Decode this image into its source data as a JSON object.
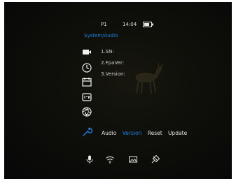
{
  "status_bar": {
    "profile": "P1",
    "time": "14:04"
  },
  "breadcrumb": "System/Audio",
  "info": {
    "sn_label": "1.SN:",
    "fpaver_label": "2.FpaVer:",
    "version_label": "3.Version:"
  },
  "tabs": [
    {
      "label": "Audio",
      "active": false
    },
    {
      "label": "Version",
      "active": true
    },
    {
      "label": "Reset",
      "active": false
    },
    {
      "label": "Update",
      "active": false
    }
  ],
  "colors": {
    "accent": "#1f7fe0",
    "text": "#d9d9d9",
    "background": "#0b0b08"
  },
  "sidebar_icons": [
    "video-icon",
    "clock-icon",
    "calendar-icon",
    "language-icon",
    "aperture-icon",
    "wrench-icon"
  ],
  "bottom_icons": [
    "microphone-icon",
    "wifi-icon",
    "image-icon",
    "pin-icon"
  ]
}
